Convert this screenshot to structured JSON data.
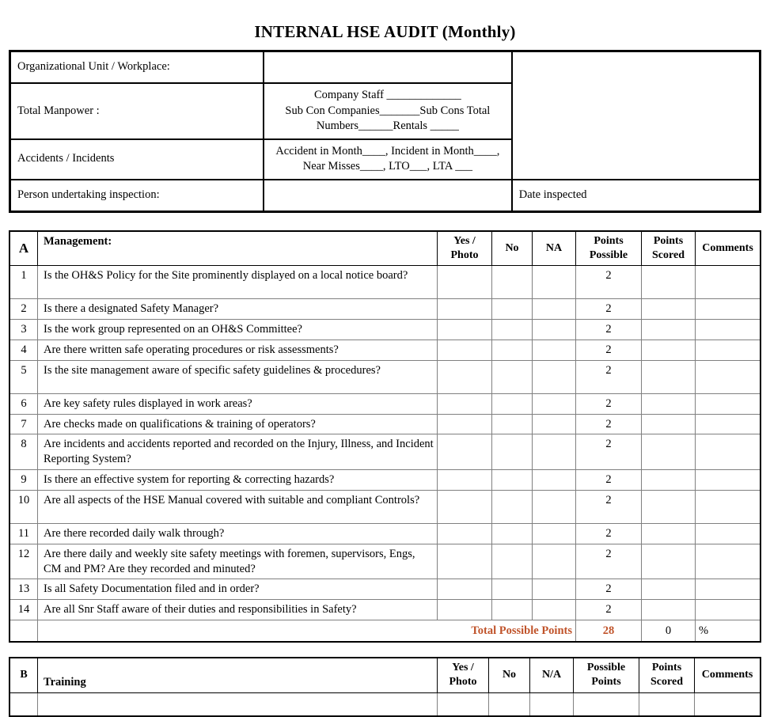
{
  "document": {
    "title": "INTERNAL HSE AUDIT (Monthly)"
  },
  "header_table": {
    "rows": [
      {
        "label": "Organizational Unit / Workplace:",
        "value": ""
      },
      {
        "label": "Total Manpower :",
        "value_line1": "Company Staff _____________",
        "value_line2": "Sub Con Companies_______Sub Cons Total Numbers______Rentals _____"
      },
      {
        "label": "Accidents / Incidents",
        "value": "Accident in Month____, Incident in Month____, Near Misses____, LTO___, LTA ___"
      },
      {
        "label": "Person undertaking inspection:",
        "value": "",
        "date_label": "Date inspected",
        "date_value": ""
      }
    ]
  },
  "section_a": {
    "letter": "A",
    "columns": {
      "item": "Management:",
      "yes": "Yes / Photo",
      "no": "No",
      "na": "NA",
      "possible": "Points Possible",
      "scored": "Points Scored",
      "comments": "Comments"
    },
    "rows": [
      {
        "num": "1",
        "question": "Is the OH&S Policy for the Site prominently displayed on a local notice board?",
        "possible": "2",
        "scored": "",
        "comments": "",
        "lines": 2
      },
      {
        "num": "2",
        "question": "Is there a designated Safety Manager?",
        "possible": "2",
        "scored": "",
        "comments": "",
        "lines": 1
      },
      {
        "num": "3",
        "question": "Is the work group represented on an OH&S Committee?",
        "possible": "2",
        "scored": "",
        "comments": "",
        "lines": 1
      },
      {
        "num": "4",
        "question": "Are there written safe operating procedures or risk assessments?",
        "possible": "2",
        "scored": "",
        "comments": "",
        "lines": 1
      },
      {
        "num": "5",
        "question": "Is the site management aware of specific safety guidelines & procedures?",
        "possible": "2",
        "scored": "",
        "comments": "",
        "lines": 2
      },
      {
        "num": "6",
        "question": "Are key safety rules displayed in work areas?",
        "possible": "2",
        "scored": "",
        "comments": "",
        "lines": 1
      },
      {
        "num": "7",
        "question": "Are checks made on qualifications & training of operators?",
        "possible": "2",
        "scored": "",
        "comments": "",
        "lines": 1
      },
      {
        "num": "8",
        "question": "Are incidents and accidents reported and recorded on the Injury, Illness, and Incident Reporting System?",
        "possible": "2",
        "scored": "",
        "comments": "",
        "lines": 2
      },
      {
        "num": "9",
        "question": "Is there an effective system for reporting & correcting hazards?",
        "possible": "2",
        "scored": "",
        "comments": "",
        "lines": 1
      },
      {
        "num": "10",
        "question": "Are all aspects of the HSE Manual covered with suitable and compliant Controls?",
        "possible": "2",
        "scored": "",
        "comments": "",
        "lines": 2
      },
      {
        "num": "11",
        "question": "Are there recorded daily walk through?",
        "possible": "2",
        "scored": "",
        "comments": "",
        "lines": 1
      },
      {
        "num": "12",
        "question": "Are there daily and weekly site safety meetings with foremen, supervisors, Engs, CM and PM? Are they recorded and minuted?",
        "possible": "2",
        "scored": "",
        "comments": "",
        "lines": 2
      },
      {
        "num": "13",
        "question": "Is all Safety Documentation filed and in order?",
        "possible": "2",
        "scored": "",
        "comments": "",
        "lines": 1
      },
      {
        "num": "14",
        "question": "Are all Snr Staff aware of their duties and responsibilities in Safety?",
        "possible": "2",
        "scored": "",
        "comments": "",
        "lines": 1
      }
    ],
    "total": {
      "label": "Total Possible Points",
      "possible": "28",
      "scored": "0",
      "percent": "%"
    }
  },
  "section_b": {
    "letter": "B",
    "columns": {
      "item": "Training",
      "yes": "Yes / Photo",
      "no": "No",
      "na": "N/A",
      "possible": "Possible Points",
      "scored": "Points Scored",
      "comments": "Comments"
    }
  },
  "colors": {
    "accent_orange": "#C0532A",
    "grid_line": "#808080",
    "border": "#000000"
  }
}
